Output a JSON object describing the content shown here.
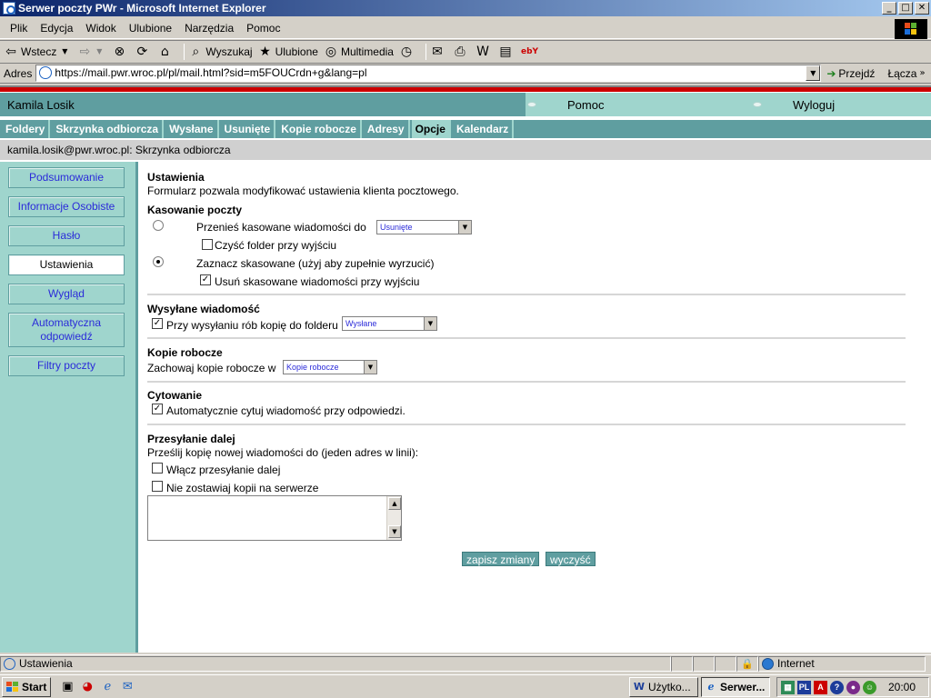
{
  "window": {
    "title": "Serwer poczty PWr - Microsoft Internet Explorer",
    "controls": [
      "_",
      "□",
      "✕"
    ]
  },
  "menu": [
    "Plik",
    "Edycja",
    "Widok",
    "Ulubione",
    "Narzędzia",
    "Pomoc"
  ],
  "toolbar": {
    "back": "Wstecz",
    "search": "Wyszukaj",
    "favorites": "Ulubione",
    "multimedia": "Multimedia"
  },
  "address": {
    "label": "Adres",
    "url": "https://mail.pwr.wroc.pl/pl/mail.html?sid=m5FOUCrdn+g&lang=pl",
    "go": "Przejdź",
    "links": "Łącza"
  },
  "header": {
    "user": "Kamila Losik",
    "help": "Pomoc",
    "logout": "Wyloguj"
  },
  "nav": {
    "tabs": [
      "Foldery",
      "Skrzynka odbiorcza",
      "Wysłane",
      "Usunięte",
      "Kopie robocze",
      "Adresy",
      "Opcje",
      "Kalendarz"
    ],
    "active": "Opcje"
  },
  "breadcrumb": "kamila.losik@pwr.wroc.pl: Skrzynka odbiorcza",
  "sidebar": {
    "items": [
      "Podsumowanie",
      "Informacje Osobiste",
      "Hasło",
      "Ustawienia",
      "Wygląd",
      "Automatyczna odpowiedź",
      "Filtry poczty"
    ],
    "active": "Ustawienia"
  },
  "settings": {
    "title": "Ustawienia",
    "intro": "Formularz pozwala modyfikować ustawienia klienta pocztowego.",
    "delete": {
      "title": "Kasowanie poczty",
      "move_option": "Przenieś kasowane wiadomości do",
      "move_folder": "Usunięte",
      "clear_on_exit": "Czyść folder przy wyjściu",
      "mark_option": "Zaznacz skasowane (użyj aby zupełnie wyrzucić)",
      "remove_on_exit": "Usuń skasowane wiadomości przy wyjściu"
    },
    "sent": {
      "title": "Wysyłane wiadomość",
      "copy_label": "Przy wysyłaniu rób kopię do folderu",
      "copy_folder": "Wysłane"
    },
    "drafts": {
      "title": "Kopie robocze",
      "keep_label": "Zachowaj kopie robocze w",
      "folder": "Kopie robocze"
    },
    "quoting": {
      "title": "Cytowanie",
      "auto_quote": "Automatycznie cytuj wiadomość przy odpowiedzi."
    },
    "forwarding": {
      "title": "Przesyłanie dalej",
      "description": "Prześlij kopię nowej wiadomości do (jeden adres w linii):",
      "enable": "Włącz przesyłanie dalej",
      "no_copy": "Nie zostawiaj kopii na serwerze"
    },
    "save_button": "zapisz zmiany",
    "clear_button": "wyczyść"
  },
  "status": {
    "text": "Ustawienia",
    "zone": "Internet"
  },
  "taskbar": {
    "start": "Start",
    "tasks": [
      "Użytko...",
      "Serwer..."
    ],
    "lang": "PL",
    "clock": "20:00"
  }
}
